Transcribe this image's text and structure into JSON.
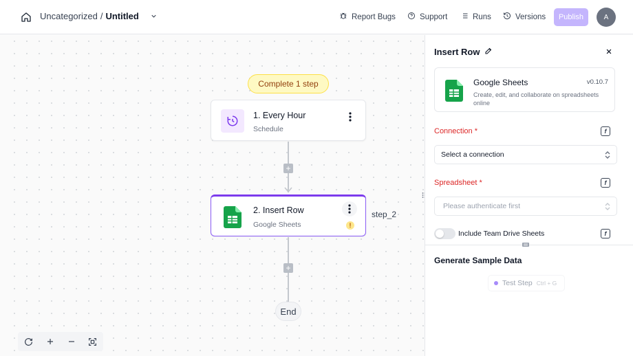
{
  "header": {
    "breadcrumb_folder": "Uncategorized",
    "breadcrumb_sep": "/",
    "flow_title": "Untitled",
    "actions": {
      "report_bugs": "Report Bugs",
      "support": "Support",
      "runs": "Runs",
      "versions": "Versions"
    },
    "publish_label": "Publish",
    "avatar_initial": "A"
  },
  "canvas": {
    "step_hint": "Complete 1 step",
    "nodes": [
      {
        "title": "1. Every Hour",
        "subtitle": "Schedule",
        "icon": "clock-icon"
      },
      {
        "title": "2. Insert Row",
        "subtitle": "Google Sheets",
        "icon": "google-sheets-icon",
        "warning": "!"
      }
    ],
    "step_label": "step_2",
    "end_label": "End",
    "add_label": "+"
  },
  "panel": {
    "title": "Insert Row",
    "piece": {
      "name": "Google Sheets",
      "version": "v0.10.7",
      "description": "Create, edit, and collaborate on spreadsheets online"
    },
    "connection": {
      "label": "Connection",
      "required_mark": "*",
      "value": "Select a connection"
    },
    "spreadsheet": {
      "label": "Spreadsheet",
      "required_mark": "*",
      "placeholder": "Please authenticate first"
    },
    "include_team_drive": "Include Team Drive Sheets",
    "fx_label": "f",
    "sample_data_title": "Generate Sample Data",
    "test_step": {
      "label": "Test Step",
      "shortcut": "Ctrl + G"
    }
  },
  "colors": {
    "accent": "#7c3aed",
    "publish": "#c4b5fd",
    "sheets_green": "#16a34a",
    "required_red": "#dc2626",
    "hint_bg": "#fef9c3"
  }
}
